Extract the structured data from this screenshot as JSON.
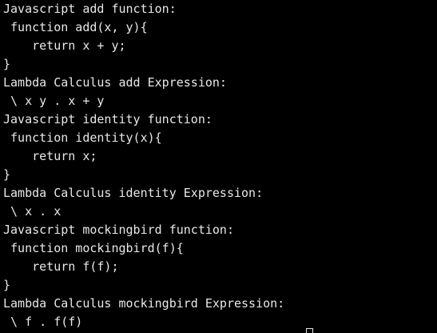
{
  "terminal": {
    "lines": [
      "Javascript add function:",
      " function add(x, y){",
      "    return x + y;",
      "}",
      "Lambda Calculus add Expression:",
      " \\ x y . x + y",
      "Javascript identity function:",
      " function identity(x){",
      "    return x;",
      "}",
      "Lambda Calculus identity Expression:",
      " \\ x . x",
      "Javascript mockingbird function:",
      " function mockingbird(f){",
      "    return f(f);",
      "}",
      "Lambda Calculus mockingbird Expression:",
      " \\ f . f(f)"
    ],
    "colors": {
      "background": "#000000",
      "text": "#e8e8e8"
    }
  }
}
